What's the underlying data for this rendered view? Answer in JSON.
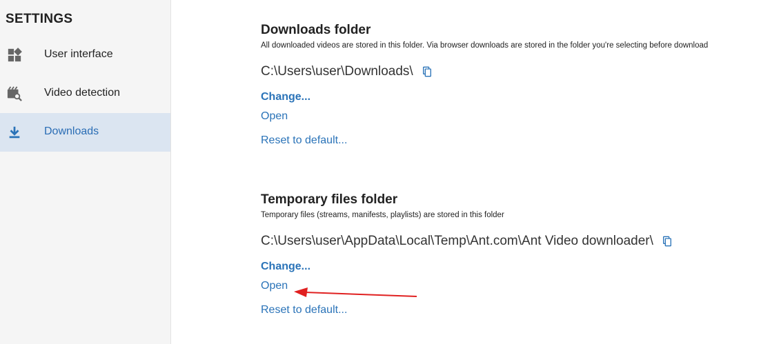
{
  "sidebar": {
    "title": "SETTINGS",
    "items": [
      {
        "label": "User interface",
        "icon": "dashboard-icon",
        "active": false
      },
      {
        "label": "Video detection",
        "icon": "video-search-icon",
        "active": false
      },
      {
        "label": "Downloads",
        "icon": "download-icon",
        "active": true
      }
    ]
  },
  "downloads_folder": {
    "title": "Downloads folder",
    "description": "All downloaded videos are stored in this folder. Via browser downloads are stored in the folder you're selecting before download",
    "path": "C:\\Users\\user\\Downloads\\",
    "change_label": "Change...",
    "open_label": "Open",
    "reset_label": "Reset to default..."
  },
  "temp_folder": {
    "title": "Temporary files folder",
    "description": "Temporary files (streams, manifests, playlists) are stored in this folder",
    "path": "C:\\Users\\user\\AppData\\Local\\Temp\\Ant.com\\Ant Video downloader\\",
    "change_label": "Change...",
    "open_label": "Open",
    "reset_label": "Reset to default..."
  },
  "colors": {
    "accent": "#2a73b8",
    "active_bg": "#dbe5f1",
    "sidebar_bg": "#f5f5f5",
    "annotation_arrow": "#e02020"
  }
}
